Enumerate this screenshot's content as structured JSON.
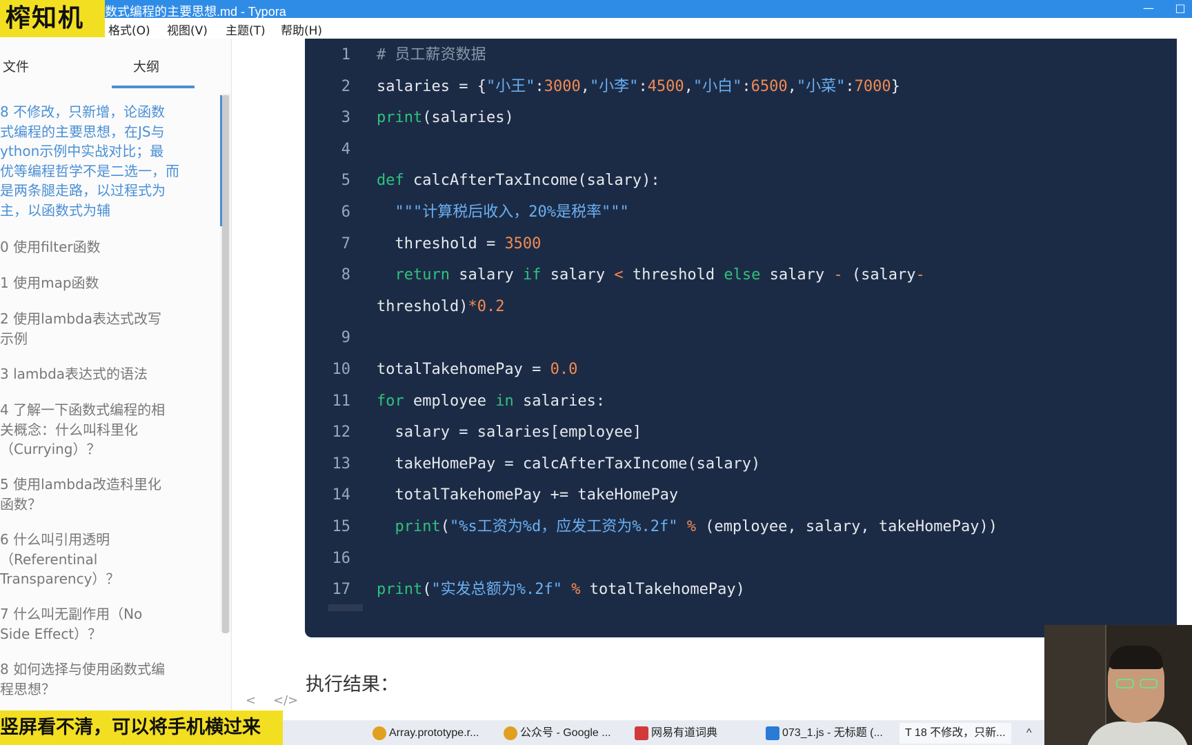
{
  "window": {
    "title": "数式编程的主要思想.md - Typora",
    "controls": [
      "—",
      "□"
    ]
  },
  "logo": {
    "text": "榨知机"
  },
  "menubar": {
    "items": [
      "格式(O)",
      "视图(V)",
      "主题(T)",
      "帮助(H)"
    ]
  },
  "sidebar": {
    "tabs": [
      "文件",
      "大纲"
    ],
    "active_tab": "大纲",
    "outline": [
      {
        "text": "8 不修改，只新增，论函数\n式编程的主要思想，在JS与\nython示例中实战对比；最\n优等编程哲学不是二选一，而\n是两条腿走路，以过程式为\n主，以函数式为辅",
        "active": true
      },
      {
        "text": "0 使用filter函数"
      },
      {
        "text": "1 使用map函数"
      },
      {
        "text": "2 使用lambda表达式改写\n示例"
      },
      {
        "text": "3 lambda表达式的语法"
      },
      {
        "text": "4 了解一下函数式编程的相\n关概念：什么叫科里化\n（Currying）？"
      },
      {
        "text": "5 使用lambda改造科里化\n函数？"
      },
      {
        "text": "6 什么叫引用透明\n（Referentinal\nTransparency）？"
      },
      {
        "text": "7 什么叫无副作用（No\nSide Effect）？"
      },
      {
        "text": "8 如何选择与使用函数式编\n程思想？"
      }
    ],
    "footer_icons": [
      "<",
      "</>"
    ]
  },
  "code": {
    "lines": [
      {
        "n": "1",
        "tokens": [
          [
            "cmt",
            "# 员工薪资数据"
          ]
        ]
      },
      {
        "n": "2",
        "tokens": [
          [
            "",
            "salaries = {"
          ],
          [
            "str",
            "\"小王\""
          ],
          [
            "",
            ":"
          ],
          [
            "num",
            "3000"
          ],
          [
            "",
            ","
          ],
          [
            "str",
            "\"小李\""
          ],
          [
            "",
            ":"
          ],
          [
            "num",
            "4500"
          ],
          [
            "",
            ","
          ],
          [
            "str",
            "\"小白\""
          ],
          [
            "",
            ":"
          ],
          [
            "num",
            "6500"
          ],
          [
            "",
            ","
          ],
          [
            "str",
            "\"小菜\""
          ],
          [
            "",
            ":"
          ],
          [
            "num",
            "7000"
          ],
          [
            "",
            "}"
          ]
        ]
      },
      {
        "n": "3",
        "tokens": [
          [
            "kw",
            "print"
          ],
          [
            "",
            "(salaries)"
          ]
        ]
      },
      {
        "n": "4",
        "tokens": []
      },
      {
        "n": "5",
        "tokens": [
          [
            "kw",
            "def"
          ],
          [
            "",
            " calcAfterTaxIncome(salary):"
          ]
        ]
      },
      {
        "n": "6",
        "tokens": [
          [
            "",
            "  "
          ],
          [
            "str",
            "\"\"\"计算税后收入，20%是税率\"\"\""
          ]
        ]
      },
      {
        "n": "7",
        "tokens": [
          [
            "",
            "  threshold = "
          ],
          [
            "num",
            "3500"
          ]
        ]
      },
      {
        "n": "8",
        "tokens": [
          [
            "",
            "  "
          ],
          [
            "kw",
            "return"
          ],
          [
            "",
            " salary "
          ],
          [
            "kw",
            "if"
          ],
          [
            "",
            " salary "
          ],
          [
            "op",
            "<"
          ],
          [
            "",
            " threshold "
          ],
          [
            "kw",
            "else"
          ],
          [
            "",
            " salary "
          ],
          [
            "op",
            "-"
          ],
          [
            "",
            " (salary"
          ],
          [
            "op",
            "-"
          ]
        ]
      },
      {
        "n": "",
        "tokens": [
          [
            "",
            "threshold)"
          ],
          [
            "op",
            "*"
          ],
          [
            "num",
            "0.2"
          ]
        ]
      },
      {
        "n": "9",
        "tokens": []
      },
      {
        "n": "10",
        "tokens": [
          [
            "",
            "totalTakehomePay = "
          ],
          [
            "num",
            "0.0"
          ]
        ]
      },
      {
        "n": "11",
        "tokens": [
          [
            "kw",
            "for"
          ],
          [
            "",
            " employee "
          ],
          [
            "kw",
            "in"
          ],
          [
            "",
            " salaries:"
          ]
        ]
      },
      {
        "n": "12",
        "tokens": [
          [
            "",
            "  salary = salaries[employee]"
          ]
        ]
      },
      {
        "n": "13",
        "tokens": [
          [
            "",
            "  takeHomePay = calcAfterTaxIncome(salary)"
          ]
        ]
      },
      {
        "n": "14",
        "tokens": [
          [
            "",
            "  totalTakehomePay += takeHomePay"
          ]
        ]
      },
      {
        "n": "15",
        "tokens": [
          [
            "",
            "  "
          ],
          [
            "kw",
            "print"
          ],
          [
            "",
            "("
          ],
          [
            "str",
            "\"%s工资为%d，应发工资为%.2f\""
          ],
          [
            "",
            " "
          ],
          [
            "op",
            "%"
          ],
          [
            "",
            " (employee, salary, takeHomePay))"
          ]
        ]
      },
      {
        "n": "16",
        "tokens": []
      },
      {
        "n": "17",
        "tokens": [
          [
            "kw",
            "print"
          ],
          [
            "",
            "("
          ],
          [
            "str",
            "\"实发总额为%.2f\""
          ],
          [
            "",
            " "
          ],
          [
            "op",
            "%"
          ],
          [
            "",
            " totalTakehomePay)"
          ]
        ]
      }
    ]
  },
  "result_label": "执行结果：",
  "banner": {
    "text": "竖屏看不清，可以将手机横过来"
  },
  "taskbar": {
    "items": [
      {
        "label": "Array.prototype.r...",
        "icon": "chrome-icon",
        "color": "#e0a020"
      },
      {
        "label": "公众号 - Google ...",
        "icon": "chrome-icon",
        "color": "#e0a020"
      },
      {
        "label": "网易有道词典",
        "icon": "youdao-icon",
        "color": "#d23a3a"
      },
      {
        "label": "073_1.js - 无标题 (...",
        "icon": "vscode-icon",
        "color": "#2a7bd6"
      },
      {
        "label": "T  18 不修改，只新...",
        "icon": "typora-icon",
        "color": "#ffffff"
      }
    ],
    "tray_icon": "^"
  },
  "colors": {
    "titlebar": "#2f8ce6",
    "code_bg": "#1c2b45",
    "keyword": "#2ec27e",
    "string": "#6ab0f3",
    "number": "#f28b54",
    "accent": "#4a8fd6",
    "banner": "#f3df21"
  }
}
